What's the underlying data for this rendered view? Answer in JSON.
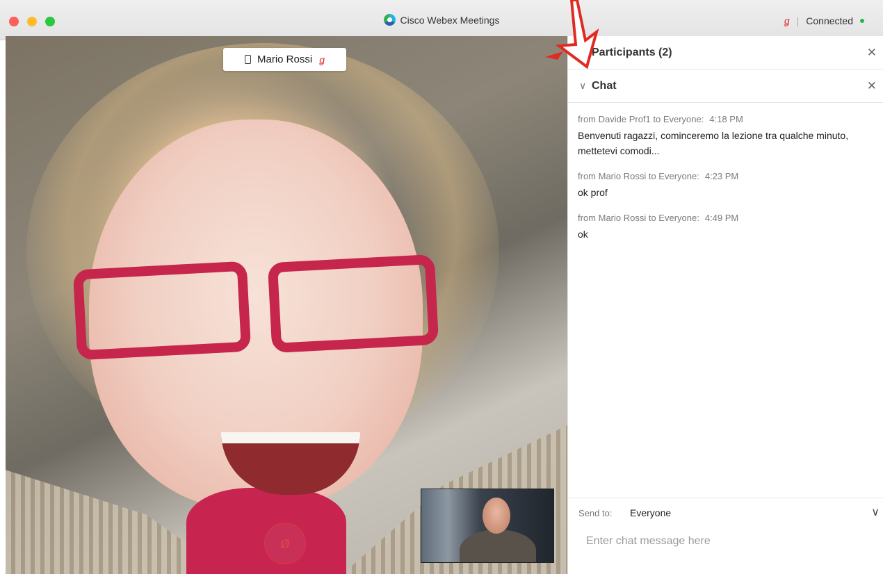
{
  "window": {
    "title": "Cisco Webex Meetings",
    "connection_status": "Connected",
    "mic_status_icon": "mic-muted-icon"
  },
  "video": {
    "participant_name": "Mario Rossi",
    "device_icon": "phone-icon",
    "mute_button_icon": "mic-muted-icon"
  },
  "panel": {
    "participants_title": "Participants (2)",
    "chat_title": "Chat",
    "messages": [
      {
        "meta": "from Davide Prof1 to Everyone:",
        "time": "4:18  PM",
        "text": "Benvenuti ragazzi, cominceremo la lezione tra qualche minuto, mettetevi comodi..."
      },
      {
        "meta": "from Mario Rossi to Everyone:",
        "time": "4:23  PM",
        "text": "ok prof"
      },
      {
        "meta": "from Mario Rossi to Everyone:",
        "time": "4:49  PM",
        "text": "ok"
      }
    ],
    "send_to_label": "Send to:",
    "send_to_value": "Everyone",
    "chat_input_placeholder": "Enter chat message here",
    "chat_input_value": ""
  },
  "colors": {
    "annotation_arrow": "#e02a22",
    "muted_red": "#e0262a",
    "connected_green": "#1fb94a"
  }
}
